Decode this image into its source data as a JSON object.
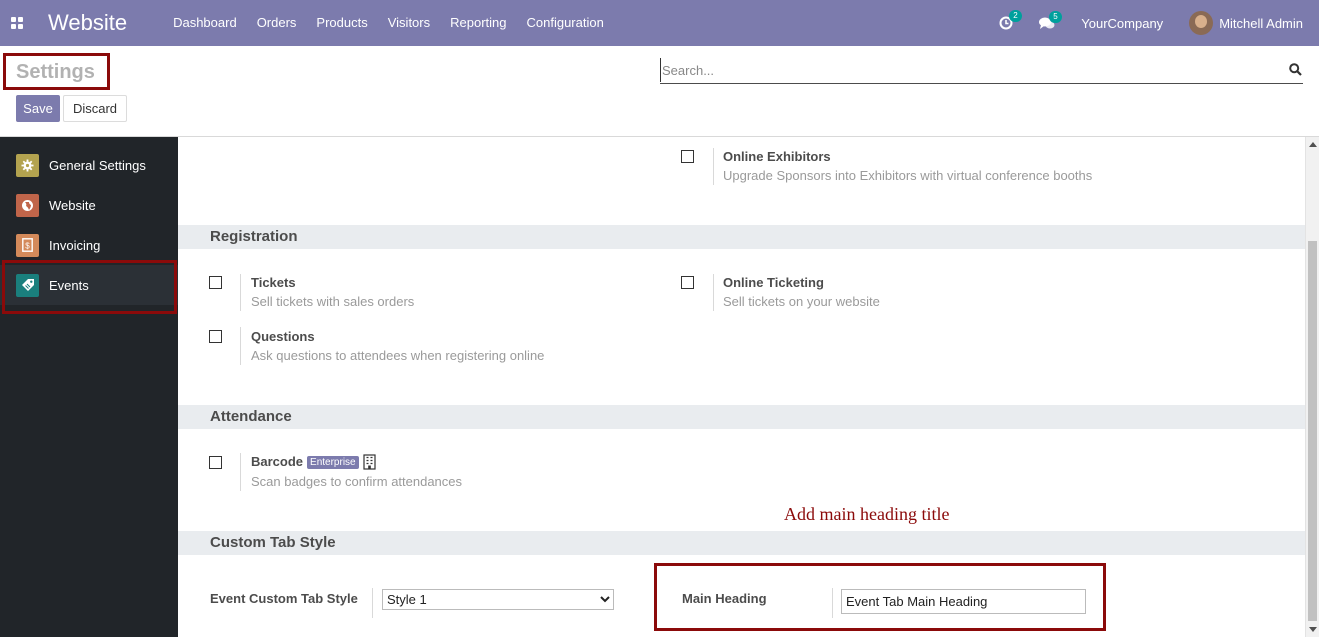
{
  "navbar": {
    "app_title": "Website",
    "menu": [
      "Dashboard",
      "Orders",
      "Products",
      "Visitors",
      "Reporting",
      "Configuration"
    ],
    "activity_count": "2",
    "messages_count": "5",
    "company": "YourCompany",
    "user": "Mitchell Admin",
    "bg_color": "#7c7bad"
  },
  "control_panel": {
    "title": "Settings",
    "save_label": "Save",
    "discard_label": "Discard",
    "search_placeholder": "Search..."
  },
  "sidebar": {
    "items": [
      {
        "label": "General Settings",
        "icon": "gear-icon",
        "color": "#b3a34f"
      },
      {
        "label": "Website",
        "icon": "globe-icon",
        "color": "#c0654a"
      },
      {
        "label": "Invoicing",
        "icon": "invoice-icon",
        "color": "#d48a5a"
      },
      {
        "label": "Events",
        "icon": "ticket-icon",
        "color": "#1a7f7d"
      }
    ],
    "active": "Events"
  },
  "sections": {
    "top": {
      "online_exhibitors_title": "Online Exhibitors",
      "online_exhibitors_desc": "Upgrade Sponsors into Exhibitors with virtual conference booths"
    },
    "registration": {
      "heading": "Registration",
      "tickets_title": "Tickets",
      "tickets_desc": "Sell tickets with sales orders",
      "online_ticketing_title": "Online Ticketing",
      "online_ticketing_desc": "Sell tickets on your website",
      "questions_title": "Questions",
      "questions_desc": "Ask questions to attendees when registering online"
    },
    "attendance": {
      "heading": "Attendance",
      "barcode_title": "Barcode",
      "barcode_badge": "Enterprise",
      "barcode_desc": "Scan badges to confirm attendances"
    },
    "custom_tab_style": {
      "heading": "Custom Tab Style",
      "style_label": "Event Custom Tab Style",
      "style_value": "Style 1",
      "main_heading_label": "Main Heading",
      "main_heading_value": "Event Tab Main Heading"
    }
  },
  "annotation": "Add main heading title",
  "annotation_color": "#8b0a0a"
}
